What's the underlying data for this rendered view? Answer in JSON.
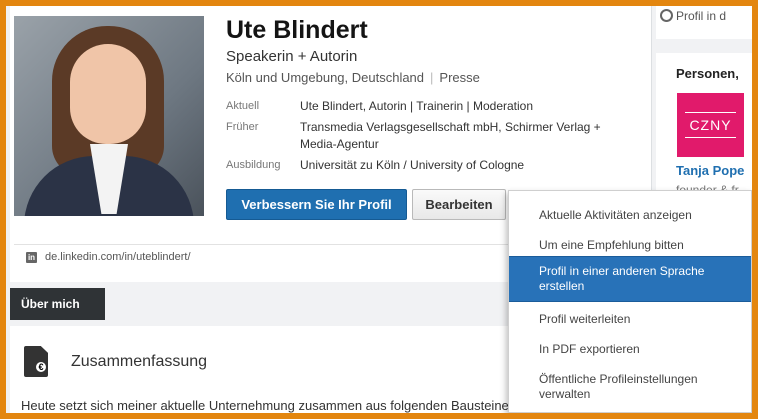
{
  "profile": {
    "name": "Ute Blindert",
    "headline": "Speakerin + Autorin",
    "location": "Köln und Umgebung, Deutschland",
    "industry": "Presse",
    "details": [
      {
        "label": "Aktuell",
        "value": "Ute Blindert, Autorin | Trainerin | Moderation"
      },
      {
        "label": "Früher",
        "value": "Transmedia Verlagsgesellschaft mbH, Schirmer Verlag + Media-Agentur"
      },
      {
        "label": "Ausbildung",
        "value": "Universität zu Köln / University of Cologne"
      }
    ],
    "improve_button": "Verbessern Sie Ihr Profil",
    "edit_button": "Bearbeiten",
    "public_url": "de.linkedin.com/in/uteblindert/",
    "linkedin_icon_text": "in"
  },
  "section": {
    "tab_label": "Über mich",
    "summary_title": "Zusammenfassung",
    "summary_text": "Heute setzt sich meiner aktuelle Unternehmung zusammen aus folgenden Bausteine",
    "summary_icon_text": "€"
  },
  "sidebar": {
    "top_link": "Profil in d",
    "people_title": "Personen,",
    "logo_text": "CZNY",
    "person_name": "Tanja Pope",
    "person_sub": "founder & fr"
  },
  "menu": {
    "items": [
      "Aktuelle Aktivitäten anzeigen",
      "Um eine Empfehlung bitten",
      "Profil in einer anderen Sprache erstellen",
      "Profil weiterleiten",
      "In PDF exportieren",
      "Öffentliche Profileinstellungen verwalten"
    ],
    "active_index": 2
  },
  "colors": {
    "frame": "#e3860f",
    "primary_button": "#1f6fb0",
    "menu_highlight": "#2872b8",
    "logo": "#e11a6b"
  }
}
